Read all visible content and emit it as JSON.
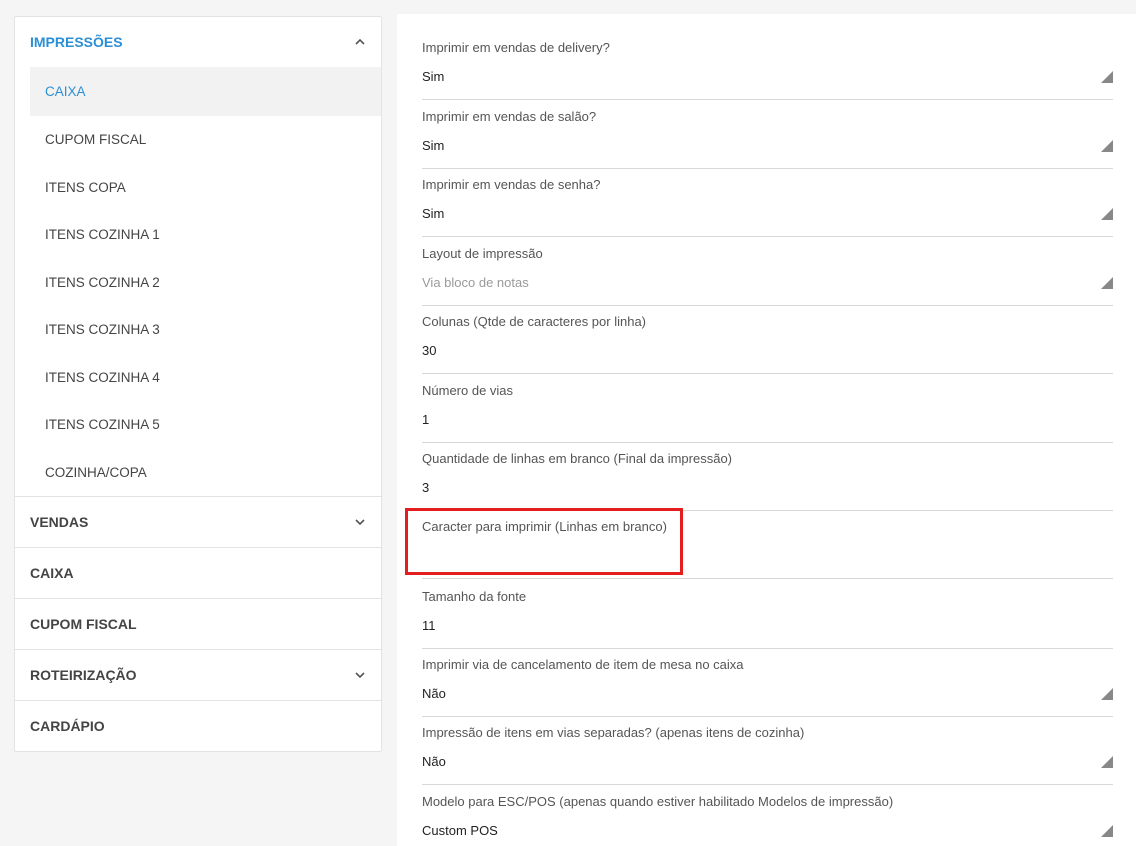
{
  "sidebar": {
    "sections": [
      {
        "label": "IMPRESSÕES",
        "expanded": true,
        "chevron": "chevron-up-icon"
      },
      {
        "label": "VENDAS",
        "chevron": "chevron-down-icon"
      },
      {
        "label": "CAIXA"
      },
      {
        "label": "CUPOM FISCAL"
      },
      {
        "label": "ROTEIRIZAÇÃO",
        "chevron": "chevron-down-icon"
      },
      {
        "label": "CARDÁPIO"
      }
    ],
    "sub_items": [
      "CAIXA",
      "CUPOM FISCAL",
      "ITENS COPA",
      "ITENS COZINHA 1",
      "ITENS COZINHA 2",
      "ITENS COZINHA 3",
      "ITENS COZINHA 4",
      "ITENS COZINHA 5",
      "COZINHA/COPA"
    ],
    "active_sub_item": "CAIXA"
  },
  "form": {
    "fields": [
      {
        "label": "Imprimir em vendas de delivery?",
        "value": "Sim",
        "type": "select"
      },
      {
        "label": "Imprimir em vendas de salão?",
        "value": "Sim",
        "type": "select"
      },
      {
        "label": "Imprimir em vendas de senha?",
        "value": "Sim",
        "type": "select"
      },
      {
        "label": "Layout de impressão",
        "placeholder": "Via bloco de notas",
        "value": "",
        "type": "select"
      },
      {
        "label": "Colunas (Qtde de caracteres por linha)",
        "value": "30",
        "type": "input"
      },
      {
        "label": "Número de vias",
        "value": "1",
        "type": "input"
      },
      {
        "label": "Quantidade de linhas em branco (Final da impressão)",
        "value": "3",
        "type": "input"
      },
      {
        "label": "Caracter para imprimir (Linhas em branco)",
        "value": "",
        "type": "input"
      },
      {
        "label": "Tamanho da fonte",
        "value": "11",
        "type": "input"
      },
      {
        "label": "Imprimir via de cancelamento de item de mesa no caixa",
        "value": "Não",
        "type": "select"
      },
      {
        "label": "Impressão de itens em vias separadas? (apenas itens de cozinha)",
        "value": "Não",
        "type": "select"
      },
      {
        "label": "Modelo para ESC/POS (apenas quando estiver habilitado Modelos de impressão)",
        "value": "Custom POS",
        "type": "select"
      }
    ]
  },
  "colors": {
    "accent": "#2b8fd6",
    "highlight_border": "#e41e1e",
    "background": "#f5f5f5"
  }
}
